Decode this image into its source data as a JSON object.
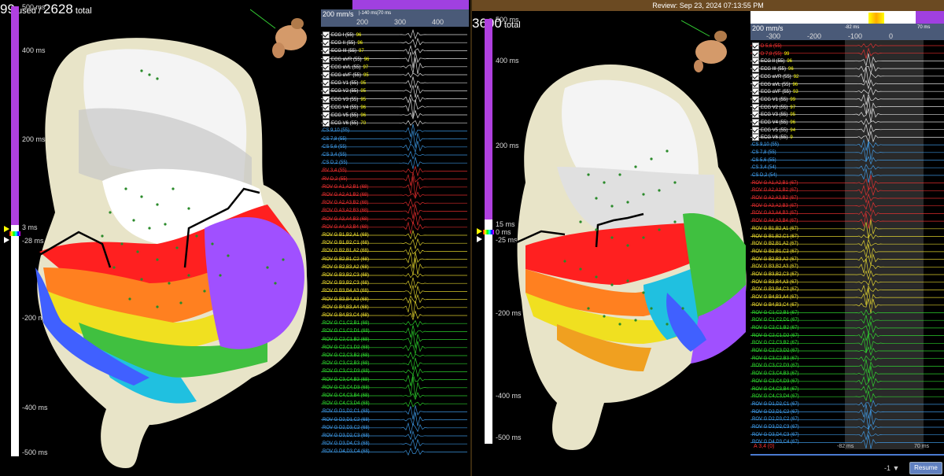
{
  "left": {
    "counts": {
      "used_prefix": "99",
      "used_suffix": " used / ",
      "total": "2628",
      "total_suffix": " total"
    },
    "scale": {
      "top": "500 ms",
      "t400": "400 ms",
      "t200": "200 ms",
      "anno_upper": "3 ms",
      "anno_lower": "-28 ms",
      "tm200": "-200 ms",
      "tm400": "-400 ms",
      "bottom": "-500 ms"
    },
    "speed": "200 mm/s",
    "window_label": "|-140 ms|70 ms",
    "ticks": [
      "200",
      "300",
      "400"
    ],
    "channels": [
      {
        "label": "ECG I (55)",
        "val": "96",
        "color": "#ffffff",
        "check": true
      },
      {
        "label": "ECG II (55)",
        "val": "96",
        "color": "#ffffff",
        "check": true
      },
      {
        "label": "ECG III (55)",
        "val": "97",
        "color": "#ffffff",
        "check": true
      },
      {
        "label": "ECG aVR (55)",
        "val": "96",
        "color": "#ffffff",
        "check": true
      },
      {
        "label": "ECG aVL (55)",
        "val": "97",
        "color": "#ffffff",
        "check": true
      },
      {
        "label": "ECG aVF (55)",
        "val": "95",
        "color": "#ffffff",
        "check": true
      },
      {
        "label": "ECG V1 (55)",
        "val": "95",
        "color": "#ffffff",
        "check": true
      },
      {
        "label": "ECG V2 (55)",
        "val": "95",
        "color": "#ffffff",
        "check": true
      },
      {
        "label": "ECG V3 (55)",
        "val": "95",
        "color": "#ffffff",
        "check": true
      },
      {
        "label": "ECG V4 (55)",
        "val": "96",
        "color": "#ffffff",
        "check": true
      },
      {
        "label": "ECG V5 (55)",
        "val": "96",
        "color": "#ffffff",
        "check": true
      },
      {
        "label": "ECG V6 (55)",
        "val": "70",
        "color": "#ffffff",
        "check": true
      },
      {
        "label": "CS 9,10 (55)",
        "val": "",
        "color": "#44aaff",
        "check": false
      },
      {
        "label": "CS 7,8 (55)",
        "val": "",
        "color": "#44aaff",
        "check": false
      },
      {
        "label": "CS 5,6 (55)",
        "val": "",
        "color": "#44aaff",
        "check": false
      },
      {
        "label": "CS 3,4 (55)",
        "val": "",
        "color": "#44aaff",
        "check": false
      },
      {
        "label": "CS D,2 (55)",
        "val": "",
        "color": "#44aaff",
        "check": false
      },
      {
        "label": "RV 3,4 (55)",
        "val": "",
        "color": "#ff3333",
        "check": false
      },
      {
        "label": "RV D,2 (55)",
        "val": "",
        "color": "#ff3333",
        "check": false
      },
      {
        "label": "ROV G  A1,A2,B1 (68)",
        "val": "",
        "color": "#ff3333",
        "check": false
      },
      {
        "label": "ROV G  A2,A1,B2 (68)",
        "val": "",
        "color": "#ff3333",
        "check": false
      },
      {
        "label": "ROV G  A2,A3,B2 (68)",
        "val": "",
        "color": "#ff3333",
        "check": false
      },
      {
        "label": "ROV G  A3,A2,B3 (68)",
        "val": "",
        "color": "#ff3333",
        "check": false
      },
      {
        "label": "ROV G  A3,A4,B3 (68)",
        "val": "",
        "color": "#ff3333",
        "check": false
      },
      {
        "label": "ROV G  A4,A3,B4 (68)",
        "val": "",
        "color": "#ff3333",
        "check": false
      },
      {
        "label": "ROV G  B1,B2,A1 (68)",
        "val": "",
        "color": "#ffee33",
        "check": false
      },
      {
        "label": "ROV G  B1,B2,C1 (68)",
        "val": "",
        "color": "#ffee33",
        "check": false
      },
      {
        "label": "ROV G  B2,B1,A2 (68)",
        "val": "",
        "color": "#ffee33",
        "check": false
      },
      {
        "label": "ROV G  B2,B1,C2 (68)",
        "val": "",
        "color": "#ffee33",
        "check": false
      },
      {
        "label": "ROV G  B2,B3,A2 (68)",
        "val": "",
        "color": "#ffee33",
        "check": false
      },
      {
        "label": "ROV G  B3,B2,C3 (68)",
        "val": "",
        "color": "#ffee33",
        "check": false
      },
      {
        "label": "ROV G  B3,B2,C3 (68)",
        "val": "",
        "color": "#ffee33",
        "check": false
      },
      {
        "label": "ROV G  B3,B4,A3 (68)",
        "val": "",
        "color": "#ffee33",
        "check": false
      },
      {
        "label": "ROV G  B3,B4,A3 (68)",
        "val": "",
        "color": "#ffee33",
        "check": false
      },
      {
        "label": "ROV G  B4,B3,A4 (68)",
        "val": "",
        "color": "#ffee33",
        "check": false
      },
      {
        "label": "ROV G  B4,B3,C4 (68)",
        "val": "",
        "color": "#ffee33",
        "check": false
      },
      {
        "label": "ROV G  C1,C2,B1 (68)",
        "val": "",
        "color": "#33ee33",
        "check": false
      },
      {
        "label": "ROV G  C1,C2,D1 (68)",
        "val": "",
        "color": "#33ee33",
        "check": false
      },
      {
        "label": "ROV G  C2,C1,B2 (68)",
        "val": "",
        "color": "#33ee33",
        "check": false
      },
      {
        "label": "ROV G  C2,C1,D2 (68)",
        "val": "",
        "color": "#33ee33",
        "check": false
      },
      {
        "label": "ROV G  C2,C3,B2 (68)",
        "val": "",
        "color": "#33ee33",
        "check": false
      },
      {
        "label": "ROV G  C3,C2,B3 (68)",
        "val": "",
        "color": "#33ee33",
        "check": false
      },
      {
        "label": "ROV G  C3,C2,D3 (68)",
        "val": "",
        "color": "#33ee33",
        "check": false
      },
      {
        "label": "ROV G  C3,C4,B3 (68)",
        "val": "",
        "color": "#33ee33",
        "check": false
      },
      {
        "label": "ROV G  C3,C4,D3 (68)",
        "val": "",
        "color": "#33ee33",
        "check": false
      },
      {
        "label": "ROV G  C4,C3,B4 (68)",
        "val": "",
        "color": "#33ee33",
        "check": false
      },
      {
        "label": "ROV G  C4,C3,D4 (68)",
        "val": "",
        "color": "#33ee33",
        "check": false
      },
      {
        "label": "ROV G  D1,D2,C1 (68)",
        "val": "",
        "color": "#44aaff",
        "check": false
      },
      {
        "label": "ROV G  D2,D1,C2 (68)",
        "val": "",
        "color": "#44aaff",
        "check": false
      },
      {
        "label": "ROV G  D2,D3,C2 (68)",
        "val": "",
        "color": "#44aaff",
        "check": false
      },
      {
        "label": "ROV G  D3,D2,C3 (68)",
        "val": "",
        "color": "#44aaff",
        "check": false
      },
      {
        "label": "ROV G  D3,D4,C3 (68)",
        "val": "",
        "color": "#44aaff",
        "check": false
      },
      {
        "label": "ROV G  D4,D3,C4 (68)",
        "val": "",
        "color": "#44aaff",
        "check": false
      }
    ]
  },
  "right": {
    "review": "Review: Sep 23, 2024 07:13:55 PM",
    "counts": {
      "total": "3600",
      "total_suffix": " total"
    },
    "scale": {
      "top": "500 ms",
      "t400": "400 ms",
      "t200": "200 ms",
      "anno_upper": "15 ms",
      "anno_mid": "0 ms",
      "anno_lower": "-25 ms",
      "tm200": "-200 ms",
      "tm400": "-400 ms",
      "bottom": "-500 ms"
    },
    "speed": "200 mm/s",
    "ticks": [
      "-300",
      "-200",
      "-100",
      "0"
    ],
    "window_left": "-82 ms",
    "window_right": "70 ms",
    "bottom_left": "A 3,4 (0)",
    "bottom_mid": "-82 ms",
    "bottom_right": "70 ms",
    "page_select": "-1 ▼",
    "resume": "Resume",
    "channels": [
      {
        "label": "D 5,6 (55)",
        "val": "",
        "color": "#ff3333",
        "check": true
      },
      {
        "label": "D 7,8 (55)",
        "val": "99",
        "color": "#ff3333",
        "check": true
      },
      {
        "label": "ECG II (55)",
        "val": "96",
        "color": "#ffffff",
        "check": true
      },
      {
        "label": "ECG III (55)",
        "val": "96",
        "color": "#ffffff",
        "check": true
      },
      {
        "label": "ECG aVR (55)",
        "val": "92",
        "color": "#ffffff",
        "check": true
      },
      {
        "label": "ECG aVL (55)",
        "val": "96",
        "color": "#ffffff",
        "check": true
      },
      {
        "label": "ECG aVF (55)",
        "val": "93",
        "color": "#ffffff",
        "check": true
      },
      {
        "label": "ECG V1 (55)",
        "val": "99",
        "color": "#ffffff",
        "check": true
      },
      {
        "label": "ECG V2 (55)",
        "val": "97",
        "color": "#ffffff",
        "check": true
      },
      {
        "label": "ECG V3 (55)",
        "val": "95",
        "color": "#ffffff",
        "check": true
      },
      {
        "label": "ECG V4 (55)",
        "val": "96",
        "color": "#ffffff",
        "check": true
      },
      {
        "label": "ECG V5 (55)",
        "val": "94",
        "color": "#ffffff",
        "check": true
      },
      {
        "label": "ECG V6 (55)",
        "val": "9",
        "color": "#ffffff",
        "check": true
      },
      {
        "label": "CS 9,10 (55)",
        "val": "",
        "color": "#44aaff",
        "check": false
      },
      {
        "label": "CS 7,8 (55)",
        "val": "",
        "color": "#44aaff",
        "check": false
      },
      {
        "label": "CS 5,6 (55)",
        "val": "",
        "color": "#44aaff",
        "check": false
      },
      {
        "label": "CS 3,4 (54)",
        "val": "",
        "color": "#44aaff",
        "check": false
      },
      {
        "label": "CS D,2 (54)",
        "val": "",
        "color": "#44aaff",
        "check": false
      },
      {
        "label": "ROV G  A1,A2,B1 (67)",
        "val": "",
        "color": "#ff3333",
        "check": false
      },
      {
        "label": "ROV G  A2,A1,B2 (67)",
        "val": "",
        "color": "#ff3333",
        "check": false
      },
      {
        "label": "ROV G  A2,A3,B2 (67)",
        "val": "",
        "color": "#ff3333",
        "check": false
      },
      {
        "label": "ROV G  A3,A2,B3 (67)",
        "val": "",
        "color": "#ff3333",
        "check": false
      },
      {
        "label": "ROV G  A3,A4,B3 (67)",
        "val": "",
        "color": "#ff3333",
        "check": false
      },
      {
        "label": "ROV G  A4,A3,B4 (67)",
        "val": "",
        "color": "#ff3333",
        "check": false
      },
      {
        "label": "ROV G  B1,B2,A1 (67)",
        "val": "",
        "color": "#ffee33",
        "check": false
      },
      {
        "label": "ROV G  B1,B2,C1 (67)",
        "val": "",
        "color": "#ffee33",
        "check": false
      },
      {
        "label": "ROV G  B2,B1,A2 (67)",
        "val": "",
        "color": "#ffee33",
        "check": false
      },
      {
        "label": "ROV G  B2,B1,C2 (67)",
        "val": "",
        "color": "#ffee33",
        "check": false
      },
      {
        "label": "ROV G  B2,B3,A2 (67)",
        "val": "",
        "color": "#ffee33",
        "check": false
      },
      {
        "label": "ROV G  B3,B2,A3 (67)",
        "val": "",
        "color": "#ffee33",
        "check": false
      },
      {
        "label": "ROV G  B3,B2,C3 (67)",
        "val": "",
        "color": "#ffee33",
        "check": false
      },
      {
        "label": "ROV G  B3,B4,A3 (67)",
        "val": "",
        "color": "#ffee33",
        "check": false
      },
      {
        "label": "ROV G  B3,B4,C3 (67)",
        "val": "",
        "color": "#ffee33",
        "check": false
      },
      {
        "label": "ROV G  B4,B3,A4 (67)",
        "val": "",
        "color": "#ffee33",
        "check": false
      },
      {
        "label": "ROV G  B4,B3,C4 (67)",
        "val": "",
        "color": "#ffee33",
        "check": false
      },
      {
        "label": "ROV G  C1,C2,B1 (67)",
        "val": "",
        "color": "#33ee33",
        "check": false
      },
      {
        "label": "ROV G  C1,C2,D1 (67)",
        "val": "",
        "color": "#33ee33",
        "check": false
      },
      {
        "label": "ROV G  C2,C1,B2 (67)",
        "val": "",
        "color": "#33ee33",
        "check": false
      },
      {
        "label": "ROV G  C2,C1,D2 (67)",
        "val": "",
        "color": "#33ee33",
        "check": false
      },
      {
        "label": "ROV G  C2,C3,B2 (67)",
        "val": "",
        "color": "#33ee33",
        "check": false
      },
      {
        "label": "ROV G  C2,C3,D2 (67)",
        "val": "",
        "color": "#33ee33",
        "check": false
      },
      {
        "label": "ROV G  C3,C2,B3 (67)",
        "val": "",
        "color": "#33ee33",
        "check": false
      },
      {
        "label": "ROV G  C3,C2,D3 (67)",
        "val": "",
        "color": "#33ee33",
        "check": false
      },
      {
        "label": "ROV G  C3,C4,B3 (67)",
        "val": "",
        "color": "#33ee33",
        "check": false
      },
      {
        "label": "ROV G  C3,C4,D3 (67)",
        "val": "",
        "color": "#33ee33",
        "check": false
      },
      {
        "label": "ROV G  C4,C3,B4 (67)",
        "val": "",
        "color": "#33ee33",
        "check": false
      },
      {
        "label": "ROV G  C4,C3,D4 (67)",
        "val": "",
        "color": "#33ee33",
        "check": false
      },
      {
        "label": "ROV G  D1,D2,C1 (67)",
        "val": "",
        "color": "#44aaff",
        "check": false
      },
      {
        "label": "ROV G  D2,D1,C2 (67)",
        "val": "",
        "color": "#44aaff",
        "check": false
      },
      {
        "label": "ROV G  D2,D3,C2 (67)",
        "val": "",
        "color": "#44aaff",
        "check": false
      },
      {
        "label": "ROV G  D3,D2,C3 (67)",
        "val": "",
        "color": "#44aaff",
        "check": false
      },
      {
        "label": "ROV G  D3,D4,C3 (67)",
        "val": "",
        "color": "#44aaff",
        "check": false
      },
      {
        "label": "ROV G  D4,D3,C4 (67)",
        "val": "",
        "color": "#44aaff",
        "check": false
      }
    ]
  },
  "colors": {
    "bar_purple": "#b040e0",
    "bg": "#000000",
    "review_brown": "#6b4a22"
  }
}
